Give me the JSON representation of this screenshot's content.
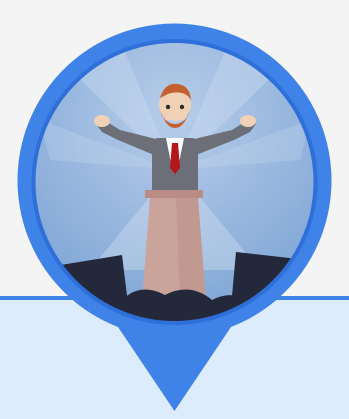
{
  "colors": {
    "background_top": "#f4f4f4",
    "background_bottom": "#dcecfd",
    "divider": "#3f82e8",
    "pin_blue": "#3f82e8",
    "pin_blue_dark": "#2f6fd9",
    "sky": "#8fb1db",
    "sky_light": "#a9c3e6",
    "spotlight": "#c8d9ef",
    "podium": "#caa39a",
    "podium_shadow": "#b98d85",
    "crowd": "#23283a",
    "suit": "#6d6f78",
    "suit_dark": "#5b5d66",
    "skin": "#f1d1b6",
    "hair": "#c4612f",
    "tie": "#b4161a"
  },
  "icons": {
    "pin": "location-pin-icon",
    "speaker": "speaker-at-podium-illustration"
  }
}
